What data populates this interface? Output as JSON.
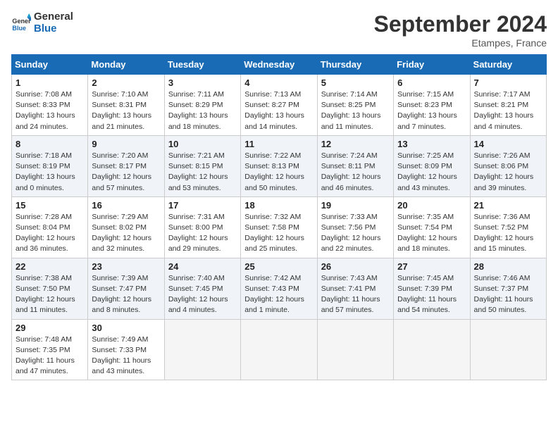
{
  "header": {
    "logo_line1": "General",
    "logo_line2": "Blue",
    "month_year": "September 2024",
    "location": "Etampes, France"
  },
  "days_of_week": [
    "Sunday",
    "Monday",
    "Tuesday",
    "Wednesday",
    "Thursday",
    "Friday",
    "Saturday"
  ],
  "weeks": [
    [
      {
        "day": 1,
        "sunrise": "7:08 AM",
        "sunset": "8:33 PM",
        "daylight": "13 hours and 24 minutes."
      },
      {
        "day": 2,
        "sunrise": "7:10 AM",
        "sunset": "8:31 PM",
        "daylight": "13 hours and 21 minutes."
      },
      {
        "day": 3,
        "sunrise": "7:11 AM",
        "sunset": "8:29 PM",
        "daylight": "13 hours and 18 minutes."
      },
      {
        "day": 4,
        "sunrise": "7:13 AM",
        "sunset": "8:27 PM",
        "daylight": "13 hours and 14 minutes."
      },
      {
        "day": 5,
        "sunrise": "7:14 AM",
        "sunset": "8:25 PM",
        "daylight": "13 hours and 11 minutes."
      },
      {
        "day": 6,
        "sunrise": "7:15 AM",
        "sunset": "8:23 PM",
        "daylight": "13 hours and 7 minutes."
      },
      {
        "day": 7,
        "sunrise": "7:17 AM",
        "sunset": "8:21 PM",
        "daylight": "13 hours and 4 minutes."
      }
    ],
    [
      {
        "day": 8,
        "sunrise": "7:18 AM",
        "sunset": "8:19 PM",
        "daylight": "13 hours and 0 minutes."
      },
      {
        "day": 9,
        "sunrise": "7:20 AM",
        "sunset": "8:17 PM",
        "daylight": "12 hours and 57 minutes."
      },
      {
        "day": 10,
        "sunrise": "7:21 AM",
        "sunset": "8:15 PM",
        "daylight": "12 hours and 53 minutes."
      },
      {
        "day": 11,
        "sunrise": "7:22 AM",
        "sunset": "8:13 PM",
        "daylight": "12 hours and 50 minutes."
      },
      {
        "day": 12,
        "sunrise": "7:24 AM",
        "sunset": "8:11 PM",
        "daylight": "12 hours and 46 minutes."
      },
      {
        "day": 13,
        "sunrise": "7:25 AM",
        "sunset": "8:09 PM",
        "daylight": "12 hours and 43 minutes."
      },
      {
        "day": 14,
        "sunrise": "7:26 AM",
        "sunset": "8:06 PM",
        "daylight": "12 hours and 39 minutes."
      }
    ],
    [
      {
        "day": 15,
        "sunrise": "7:28 AM",
        "sunset": "8:04 PM",
        "daylight": "12 hours and 36 minutes."
      },
      {
        "day": 16,
        "sunrise": "7:29 AM",
        "sunset": "8:02 PM",
        "daylight": "12 hours and 32 minutes."
      },
      {
        "day": 17,
        "sunrise": "7:31 AM",
        "sunset": "8:00 PM",
        "daylight": "12 hours and 29 minutes."
      },
      {
        "day": 18,
        "sunrise": "7:32 AM",
        "sunset": "7:58 PM",
        "daylight": "12 hours and 25 minutes."
      },
      {
        "day": 19,
        "sunrise": "7:33 AM",
        "sunset": "7:56 PM",
        "daylight": "12 hours and 22 minutes."
      },
      {
        "day": 20,
        "sunrise": "7:35 AM",
        "sunset": "7:54 PM",
        "daylight": "12 hours and 18 minutes."
      },
      {
        "day": 21,
        "sunrise": "7:36 AM",
        "sunset": "7:52 PM",
        "daylight": "12 hours and 15 minutes."
      }
    ],
    [
      {
        "day": 22,
        "sunrise": "7:38 AM",
        "sunset": "7:50 PM",
        "daylight": "12 hours and 11 minutes."
      },
      {
        "day": 23,
        "sunrise": "7:39 AM",
        "sunset": "7:47 PM",
        "daylight": "12 hours and 8 minutes."
      },
      {
        "day": 24,
        "sunrise": "7:40 AM",
        "sunset": "7:45 PM",
        "daylight": "12 hours and 4 minutes."
      },
      {
        "day": 25,
        "sunrise": "7:42 AM",
        "sunset": "7:43 PM",
        "daylight": "12 hours and 1 minute."
      },
      {
        "day": 26,
        "sunrise": "7:43 AM",
        "sunset": "7:41 PM",
        "daylight": "11 hours and 57 minutes."
      },
      {
        "day": 27,
        "sunrise": "7:45 AM",
        "sunset": "7:39 PM",
        "daylight": "11 hours and 54 minutes."
      },
      {
        "day": 28,
        "sunrise": "7:46 AM",
        "sunset": "7:37 PM",
        "daylight": "11 hours and 50 minutes."
      }
    ],
    [
      {
        "day": 29,
        "sunrise": "7:48 AM",
        "sunset": "7:35 PM",
        "daylight": "11 hours and 47 minutes."
      },
      {
        "day": 30,
        "sunrise": "7:49 AM",
        "sunset": "7:33 PM",
        "daylight": "11 hours and 43 minutes."
      },
      null,
      null,
      null,
      null,
      null
    ]
  ]
}
